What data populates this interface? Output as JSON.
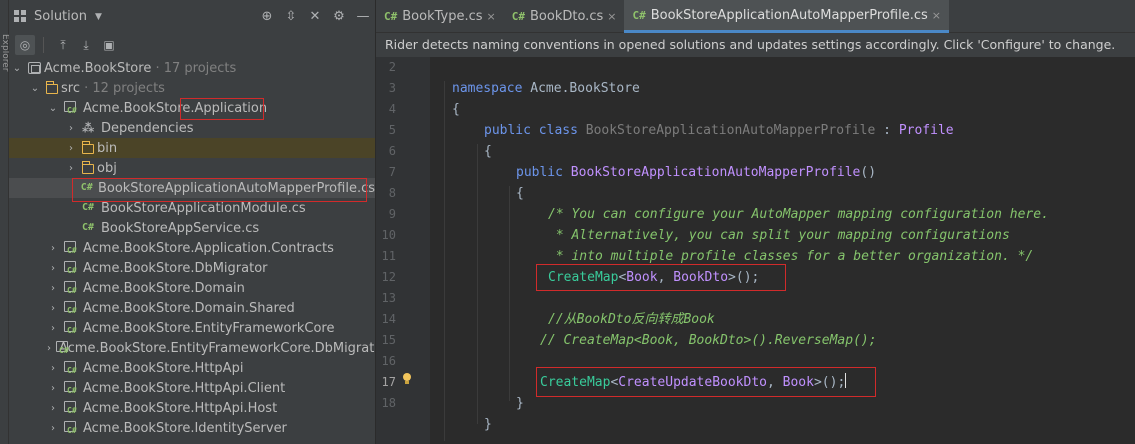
{
  "side_strip": {
    "label": "Explorer"
  },
  "solution_panel": {
    "title": "Solution",
    "tree": [
      {
        "label": "Acme.BookStore",
        "meta": " · 17 projects"
      },
      {
        "label": "src",
        "meta": " · 12 projects"
      },
      {
        "label": "Acme.BookStore.Application"
      },
      {
        "label": "Dependencies"
      },
      {
        "label": "bin"
      },
      {
        "label": "obj"
      },
      {
        "label": "BookStoreApplicationAutoMapperProfile.cs"
      },
      {
        "label": "BookStoreApplicationModule.cs"
      },
      {
        "label": "BookStoreAppService.cs"
      },
      {
        "label": "Acme.BookStore.Application.Contracts"
      },
      {
        "label": "Acme.BookStore.DbMigrator"
      },
      {
        "label": "Acme.BookStore.Domain"
      },
      {
        "label": "Acme.BookStore.Domain.Shared"
      },
      {
        "label": "Acme.BookStore.EntityFrameworkCore"
      },
      {
        "label": "Acme.BookStore.EntityFrameworkCore.DbMigrations"
      },
      {
        "label": "Acme.BookStore.HttpApi"
      },
      {
        "label": "Acme.BookStore.HttpApi.Client"
      },
      {
        "label": "Acme.BookStore.HttpApi.Host"
      },
      {
        "label": "Acme.BookStore.IdentityServer"
      }
    ]
  },
  "tabs": [
    {
      "icon": "C#",
      "label": "BookType.cs"
    },
    {
      "icon": "C#",
      "label": "BookDto.cs"
    },
    {
      "icon": "C#",
      "label": "BookStoreApplicationAutoMapperProfile.cs"
    }
  ],
  "tab_close_glyph": "×",
  "notification": "Rider detects naming conventions in opened solutions and updates settings accordingly. Click 'Configure' to change.",
  "editor": {
    "line_numbers": [
      "2",
      "3",
      "4",
      "5",
      "6",
      "7",
      "8",
      "9",
      "10",
      "11",
      "12",
      "13",
      "14",
      "15",
      "16",
      "17",
      "18"
    ],
    "current_line": "17",
    "code": {
      "l3_kw": "namespace",
      "l3_ns": "Acme.BookStore",
      "l4": "{",
      "l5_kw": "public class",
      "l5_name": "BookStoreApplicationAutoMapperProfile",
      "l5_colon": " : ",
      "l5_base": "Profile",
      "l6": "{",
      "l7_kw": "public",
      "l7_name": "BookStoreApplicationAutoMapperProfile",
      "l7_paren": "()",
      "l8": "{",
      "l9": "/* You can configure your AutoMapper mapping configuration here.",
      "l10": " * Alternatively, you can split your mapping configurations",
      "l11": " * into multiple profile classes for a better organization. */",
      "l12_fn": "CreateMap",
      "l12_lt": "<",
      "l12_t1": "Book",
      "l12_sep": ", ",
      "l12_t2": "BookDto",
      "l12_end": ">();",
      "l14": "//从BookDto反向转成Book",
      "l15": "// CreateMap<Book, BookDto>().ReverseMap();",
      "l17_fn": "CreateMap",
      "l17_lt": "<",
      "l17_t1": "CreateUpdateBookDto",
      "l17_sep": ", ",
      "l17_t2": "Book",
      "l17_end": ">();",
      "l18": "}",
      "l19": "}"
    }
  },
  "colors": {
    "accent": "#4a88c7",
    "highlight_box": "#d12b2b",
    "cs_icon": "#8fc16b",
    "folder": "#e8b54c"
  }
}
